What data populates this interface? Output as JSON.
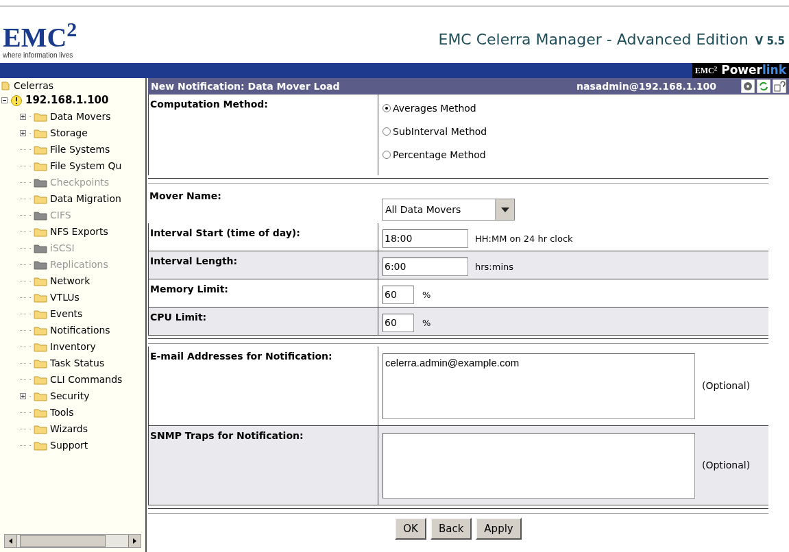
{
  "header": {
    "logo": "EMC$^{2}$",
    "tagline": "where information lives",
    "app_title": "EMC Celerra Manager - Advanced Edition",
    "version": "V 5.5",
    "powerlink_brand": "EMC$^{2}$",
    "powerlink_word": "Power",
    "powerlink_suffix": "link"
  },
  "tree": {
    "label": "Celerras",
    "children": [
      {
        "label": "192.168.1.100",
        "expanded": true,
        "children": [
          {
            "label": "Data Movers",
            "has_children": true,
            "disabled": false
          },
          {
            "label": "Storage",
            "has_children": true,
            "disabled": false
          },
          {
            "label": "File Systems",
            "has_children": false,
            "disabled": false
          },
          {
            "label": "File System Qu",
            "has_children": false,
            "disabled": false
          },
          {
            "label": "Checkpoints",
            "has_children": false,
            "disabled": true
          },
          {
            "label": "Data Migration",
            "has_children": false,
            "disabled": false
          },
          {
            "label": "CIFS",
            "has_children": false,
            "disabled": true
          },
          {
            "label": "NFS Exports",
            "has_children": false,
            "disabled": false
          },
          {
            "label": "iSCSI",
            "has_children": false,
            "disabled": true
          },
          {
            "label": "Replications",
            "has_children": false,
            "disabled": true
          },
          {
            "label": "Network",
            "has_children": false,
            "disabled": false
          },
          {
            "label": "VTLUs",
            "has_children": false,
            "disabled": false
          },
          {
            "label": "Events",
            "has_children": false,
            "disabled": false
          },
          {
            "label": "Notifications",
            "has_children": false,
            "disabled": false
          },
          {
            "label": "Inventory",
            "has_children": false,
            "disabled": false
          },
          {
            "label": "Task Status",
            "has_children": false,
            "disabled": false
          },
          {
            "label": "CLI Commands",
            "has_children": false,
            "disabled": false
          },
          {
            "label": "Security",
            "has_children": true,
            "disabled": false
          },
          {
            "label": "Tools",
            "has_children": false,
            "disabled": false
          },
          {
            "label": "Wizards",
            "has_children": false,
            "disabled": false
          },
          {
            "label": "Support",
            "has_children": false,
            "disabled": false
          }
        ]
      }
    ]
  },
  "page": {
    "title": "New Notification: Data Mover Load",
    "user": "nasadmin@192.168.1.100"
  },
  "computation": {
    "label": "Computation Method:",
    "options": [
      {
        "label": "Averages Method",
        "selected": true
      },
      {
        "label": "SubInterval Method",
        "selected": false
      },
      {
        "label": "Percentage Method",
        "selected": false
      }
    ]
  },
  "settings": [
    {
      "kind": "select",
      "label": "Mover Name:",
      "value": "All Data Movers"
    },
    {
      "kind": "text",
      "label": "Interval Start (time of day):",
      "value": "18:00",
      "hint": "HH:MM on 24 hr clock"
    },
    {
      "kind": "text",
      "label": "Interval Length:",
      "value": "6:00",
      "hint": "hrs:mins"
    },
    {
      "kind": "short",
      "label": "Memory Limit:",
      "value": "60",
      "hint": "%"
    },
    {
      "kind": "short",
      "label": "CPU Limit:",
      "value": "60",
      "hint": "%"
    }
  ],
  "recipients": [
    {
      "label": "E-mail Addresses for Notification:",
      "value": "celerra.admin@example.com",
      "note": "(Optional)"
    },
    {
      "label": "SNMP Traps for Notification:",
      "note": "(Optional)"
    }
  ],
  "buttons": [
    "OK",
    "Back",
    "Apply"
  ]
}
